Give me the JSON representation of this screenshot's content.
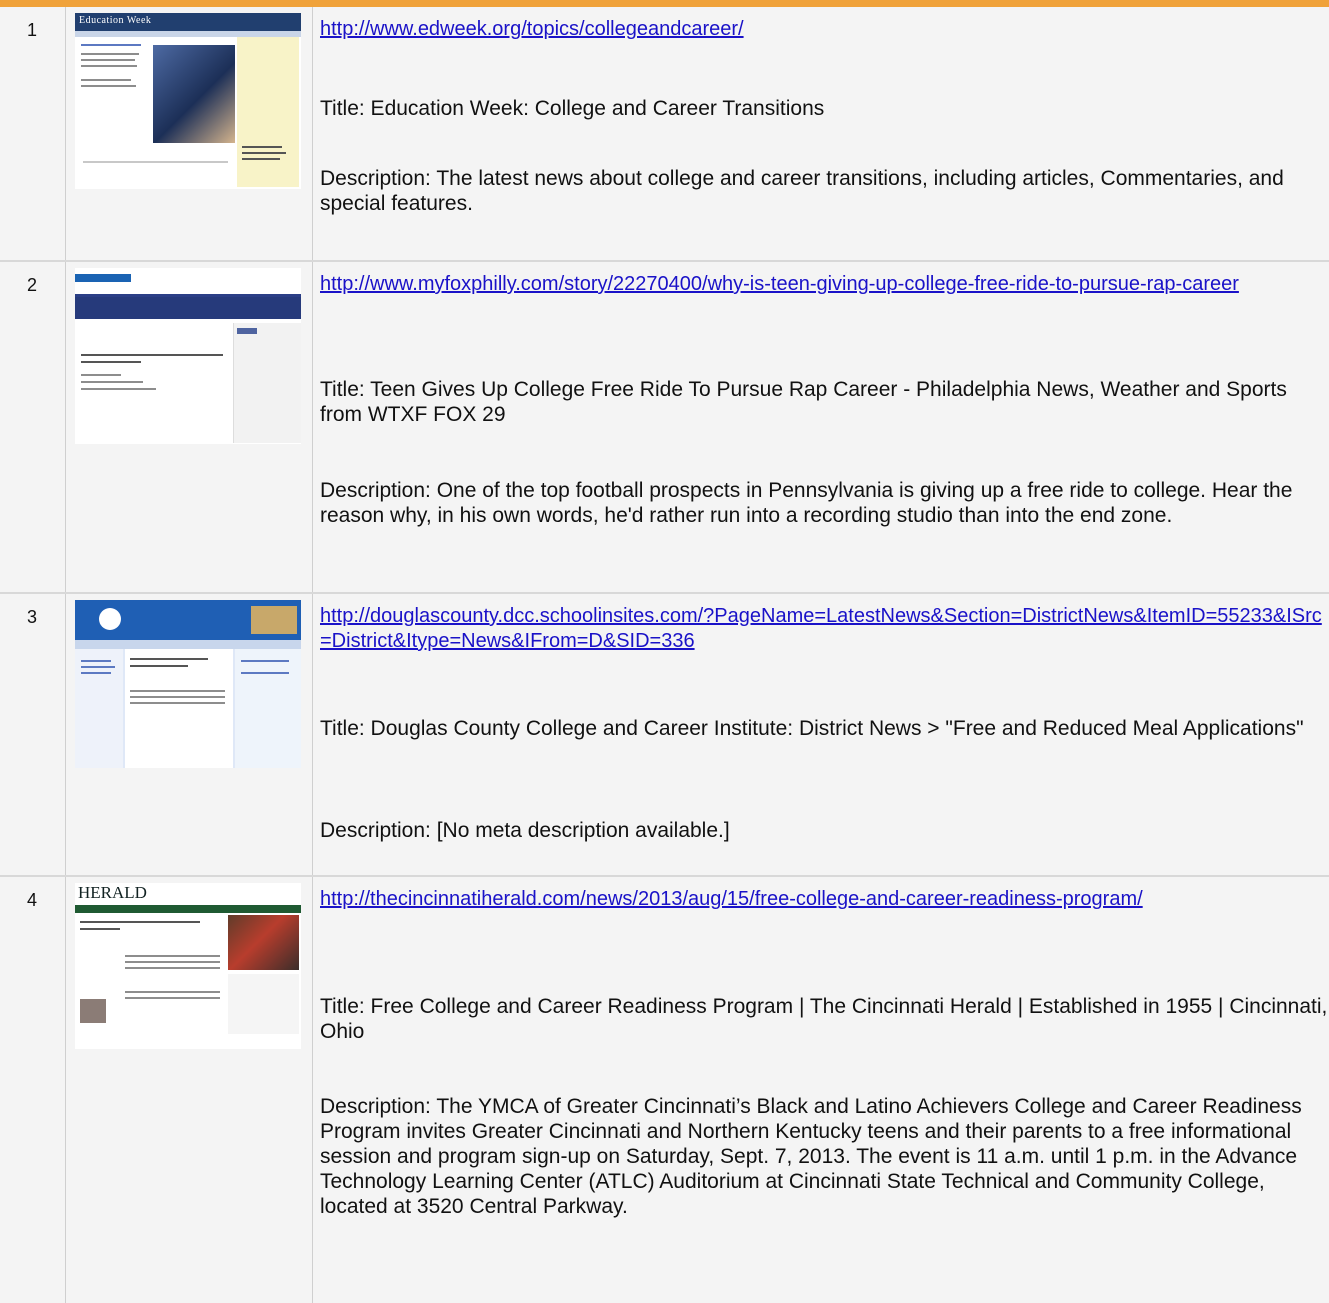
{
  "results": [
    {
      "number": "1",
      "url": "http://www.edweek.org/topics/collegeandcareer/",
      "title": "Title: Education Week: College and Career Transitions",
      "description": "Description: The latest news about college and career transitions, including articles, Commentaries, and special features.",
      "thumbnail_label": "Education Week"
    },
    {
      "number": "2",
      "url": "http://www.myfoxphilly.com/story/22270400/why-is-teen-giving-up-college-free-ride-to-pursue-rap-career",
      "title": "Title: Teen Gives Up College Free Ride To Pursue Rap Career - Philadelphia News, Weather and Sports from WTXF FOX 29",
      "description": "Description: One of the top football prospects in Pennsylvania is giving up a free ride to college. Hear the reason why, in his own words, he'd rather run into a recording studio than into the end zone."
    },
    {
      "number": "3",
      "url": "http://douglascounty.dcc.schoolinsites.com/?PageName=LatestNews&Section=DistrictNews&ItemID=55233&ISrc=District&Itype=News&IFrom=D&SID=336",
      "title": "Title: Douglas County College and Career Institute: District News > \"Free and Reduced Meal Applications\"",
      "description": "Description: [No meta description available.]"
    },
    {
      "number": "4",
      "url": "http://thecincinnatiherald.com/news/2013/aug/15/free-college-and-career-readiness-program/",
      "title": "Title: Free College and Career Readiness Program | The Cincinnati Herald | Established in 1955 | Cincinnati, Ohio",
      "description": "Description: The YMCA of Greater Cincinnati’s Black and Latino Achievers College and Career Readiness Program invites Greater Cincinnati and Northern Kentucky teens and their parents to a free informational session and program sign-up on Saturday, Sept. 7, 2013. The event is 11 a.m. until 1 p.m. in the Advance Technology Learning Center (ATLC) Auditorium at Cincinnati State Technical and Community College, located at 3520 Central Parkway.",
      "thumbnail_label": "HERALD"
    }
  ]
}
